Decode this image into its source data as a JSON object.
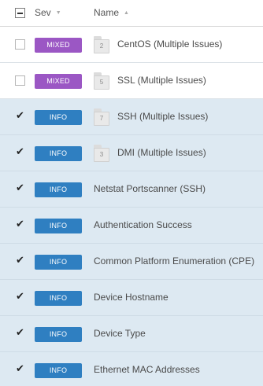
{
  "header": {
    "sev_label": "Sev",
    "sev_sort_glyph": "▼",
    "name_label": "Name",
    "name_sort_glyph": "▲"
  },
  "check_glyph": "✔",
  "rows": [
    {
      "selected": false,
      "severity": "MIXED",
      "severity_type": "mixed",
      "count": "2",
      "name": "CentOS (Multiple Issues)"
    },
    {
      "selected": false,
      "severity": "MIXED",
      "severity_type": "mixed",
      "count": "5",
      "name": "SSL (Multiple Issues)"
    },
    {
      "selected": true,
      "severity": "INFO",
      "severity_type": "info",
      "count": "7",
      "name": "SSH (Multiple Issues)"
    },
    {
      "selected": true,
      "severity": "INFO",
      "severity_type": "info",
      "count": "3",
      "name": "DMI (Multiple Issues)"
    },
    {
      "selected": true,
      "severity": "INFO",
      "severity_type": "info",
      "count": null,
      "name": "Netstat Portscanner (SSH)"
    },
    {
      "selected": true,
      "severity": "INFO",
      "severity_type": "info",
      "count": null,
      "name": "Authentication Success"
    },
    {
      "selected": true,
      "severity": "INFO",
      "severity_type": "info",
      "count": null,
      "name": "Common Platform Enumeration (CPE)"
    },
    {
      "selected": true,
      "severity": "INFO",
      "severity_type": "info",
      "count": null,
      "name": "Device Hostname"
    },
    {
      "selected": true,
      "severity": "INFO",
      "severity_type": "info",
      "count": null,
      "name": "Device Type"
    },
    {
      "selected": true,
      "severity": "INFO",
      "severity_type": "info",
      "count": null,
      "name": "Ethernet MAC Addresses"
    }
  ],
  "colors": {
    "mixed": "#9b57c4",
    "info": "#2f7fc1",
    "selected_row": "#dde9f2"
  },
  "icons": {
    "group": "folder-icon",
    "select_all": "partial-checkbox-icon",
    "checked": "checkmark-icon"
  }
}
